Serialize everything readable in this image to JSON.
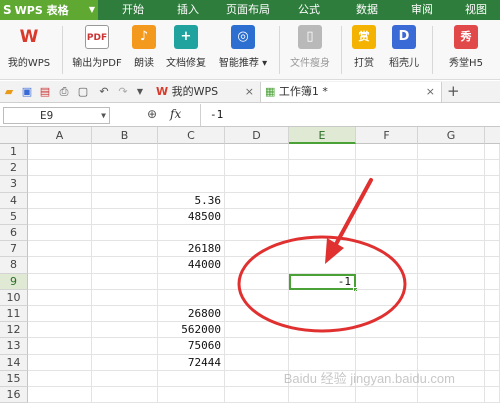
{
  "app": {
    "name": "WPS 表格"
  },
  "menu": [
    "开始",
    "插入",
    "页面布局",
    "公式",
    "数据",
    "审阅",
    "视图"
  ],
  "ribbon": {
    "my_wps": "我的WPS",
    "export_pdf": "输出为PDF",
    "read_aloud": "朗读",
    "doc_repair": "文档修复",
    "smart_recommend": "智能推荐",
    "slim_file": "文件瘦身",
    "reward": "打赏",
    "shell": "稻壳儿",
    "show_h5": "秀堂H5"
  },
  "tabs": {
    "my_wps": "我的WPS",
    "workbook": "工作簿1 *",
    "close": "×",
    "add": "+"
  },
  "formula": {
    "cell_ref": "E9",
    "fx": "fx",
    "value": "-1"
  },
  "columns": [
    "A",
    "B",
    "C",
    "D",
    "E",
    "F",
    "G"
  ],
  "rows": [
    "1",
    "2",
    "3",
    "4",
    "5",
    "6",
    "7",
    "8",
    "9",
    "10",
    "11",
    "12",
    "13",
    "14",
    "15",
    "16"
  ],
  "cells": {
    "C4": "5.36",
    "C5": "48500",
    "C7": "26180",
    "C8": "44000",
    "E9": "-1",
    "C11": "26800",
    "C12": "562000",
    "C13": "75060",
    "C14": "72444"
  },
  "watermark": "Baidu 经验 jingyan.baidu.com",
  "colors": {
    "menubar": "#2f7d3c",
    "app_button": "#5fa832",
    "selection": "#4aa136",
    "annotation": "#e03030"
  }
}
